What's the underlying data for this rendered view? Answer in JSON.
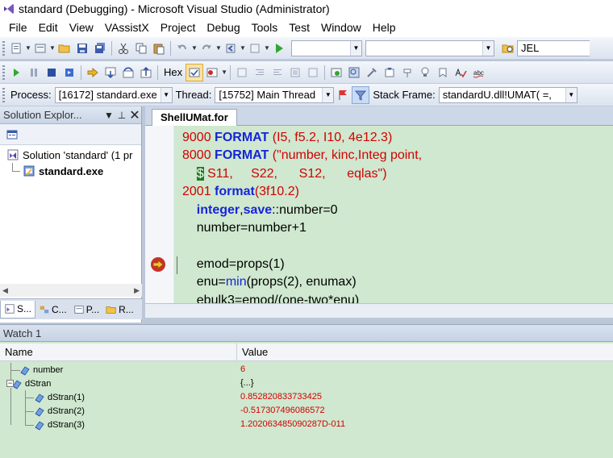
{
  "window": {
    "title": "standard (Debugging) - Microsoft Visual Studio (Administrator)"
  },
  "menu": [
    "File",
    "Edit",
    "View",
    "VAssistX",
    "Project",
    "Debug",
    "Tools",
    "Test",
    "Window",
    "Help"
  ],
  "toolbar": {
    "find_value": "JEL",
    "hex_label": "Hex"
  },
  "debug_location": {
    "process_label": "Process:",
    "process_value": "[16172] standard.exe",
    "thread_label": "Thread:",
    "thread_value": "[15752] Main Thread",
    "stack_label": "Stack Frame:",
    "stack_value": "standardU.dll!UMAT( =,"
  },
  "solution_explorer": {
    "title": "Solution Explor...",
    "pin_glyph": "⊥",
    "close_glyph": "✕",
    "solution": "Solution 'standard' (1 pr",
    "project": "standard.exe",
    "tabs": [
      "S...",
      "C...",
      "P...",
      "R..."
    ]
  },
  "editor": {
    "tab": "ShellUMat.for",
    "lines": [
      {
        "parts": [
          {
            "t": "9000 ",
            "c": "red"
          },
          {
            "t": "FORMAT",
            "c": "blu"
          },
          {
            "t": " (I5, f5.2, I10, 4e12.3)",
            "c": "red"
          }
        ]
      },
      {
        "parts": [
          {
            "t": "8000 ",
            "c": "red"
          },
          {
            "t": "FORMAT",
            "c": "blu"
          },
          {
            "t": " (\"number, kinc,Integ point,",
            "c": "red"
          }
        ]
      },
      {
        "parts": [
          {
            "t": "    ",
            "c": ""
          },
          {
            "t": "$",
            "c": "hlS"
          },
          {
            "t": " S11,     S22,      S12,      eqlas\")",
            "c": "red"
          }
        ]
      },
      {
        "parts": [
          {
            "t": "2001 ",
            "c": "red"
          },
          {
            "t": "format",
            "c": "blu"
          },
          {
            "t": "(3f10.2)",
            "c": "red"
          }
        ]
      },
      {
        "parts": [
          {
            "t": "    ",
            "c": ""
          },
          {
            "t": "integer",
            "c": "blu"
          },
          {
            "t": ",",
            "c": ""
          },
          {
            "t": "save",
            "c": "blu"
          },
          {
            "t": "::number=0",
            "c": ""
          }
        ]
      },
      {
        "parts": [
          {
            "t": "    number=number+1",
            "c": ""
          }
        ]
      },
      {
        "parts": [
          {
            "t": "",
            "c": ""
          }
        ]
      },
      {
        "parts": [
          {
            "t": "    emod=props(1)",
            "c": ""
          }
        ]
      },
      {
        "parts": [
          {
            "t": "    enu=",
            "c": ""
          },
          {
            "t": "min",
            "c": "kw"
          },
          {
            "t": "(props(2), enumax)",
            "c": ""
          }
        ]
      },
      {
        "parts": [
          {
            "t": "    ebulk3=emod/(one-two*enu)",
            "c": ""
          }
        ]
      }
    ]
  },
  "watch": {
    "title": "Watch 1",
    "col_name": "Name",
    "col_value": "Value",
    "rows": [
      {
        "name": "number",
        "value": "6",
        "red": true
      },
      {
        "name": "dStran",
        "value": "{...}",
        "red": false
      },
      {
        "name": "dStran(1)",
        "value": "0.852820833733425",
        "red": true
      },
      {
        "name": "dStran(2)",
        "value": "-0.517307496086572",
        "red": true
      },
      {
        "name": "dStran(3)",
        "value": "1.202063485090287D-011",
        "red": true
      }
    ]
  }
}
